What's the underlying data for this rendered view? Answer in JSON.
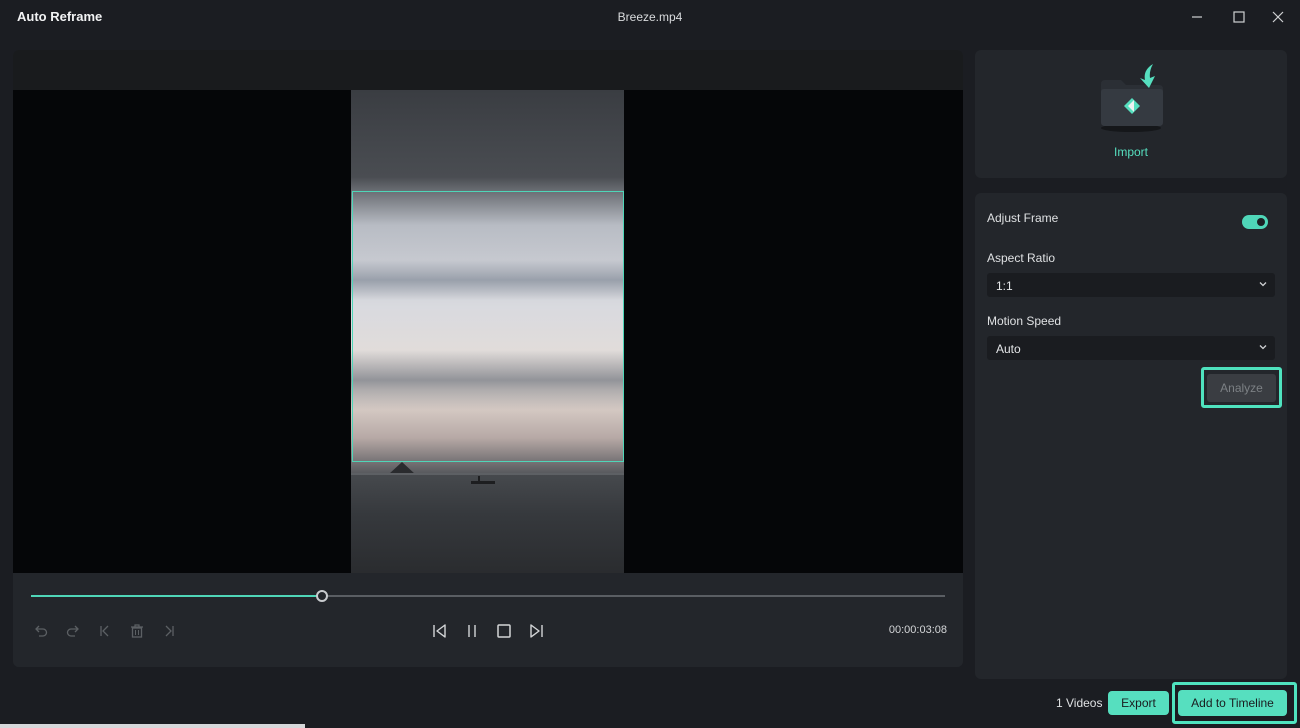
{
  "window": {
    "app_title": "Auto Reframe",
    "file_title": "Breeze.mp4",
    "controls": [
      "minimize-icon",
      "maximize-icon",
      "close-icon"
    ]
  },
  "player": {
    "progress": 0.318,
    "timecode": "00:00:03:08",
    "left_tools": [
      "undo-icon",
      "redo-icon",
      "jump-start-icon",
      "delete-icon",
      "jump-end-icon"
    ],
    "center_controls": [
      "previous-frame-icon",
      "pause-icon",
      "stop-icon",
      "next-frame-icon"
    ]
  },
  "import": {
    "label": "Import",
    "icon": "import-folder-icon"
  },
  "settings": {
    "adjust_frame_label": "Adjust Frame",
    "adjust_frame_on": true,
    "aspect_ratio_label": "Aspect Ratio",
    "aspect_ratio_value": "1:1",
    "motion_speed_label": "Motion Speed",
    "motion_speed_value": "Auto",
    "analyze_label": "Analyze"
  },
  "footer": {
    "videos_count": "1 Videos",
    "export_label": "Export",
    "add_to_timeline_label": "Add to Timeline"
  },
  "colors": {
    "accent": "#56dfbf",
    "background": "#1b1d22",
    "panel": "#23262b"
  }
}
